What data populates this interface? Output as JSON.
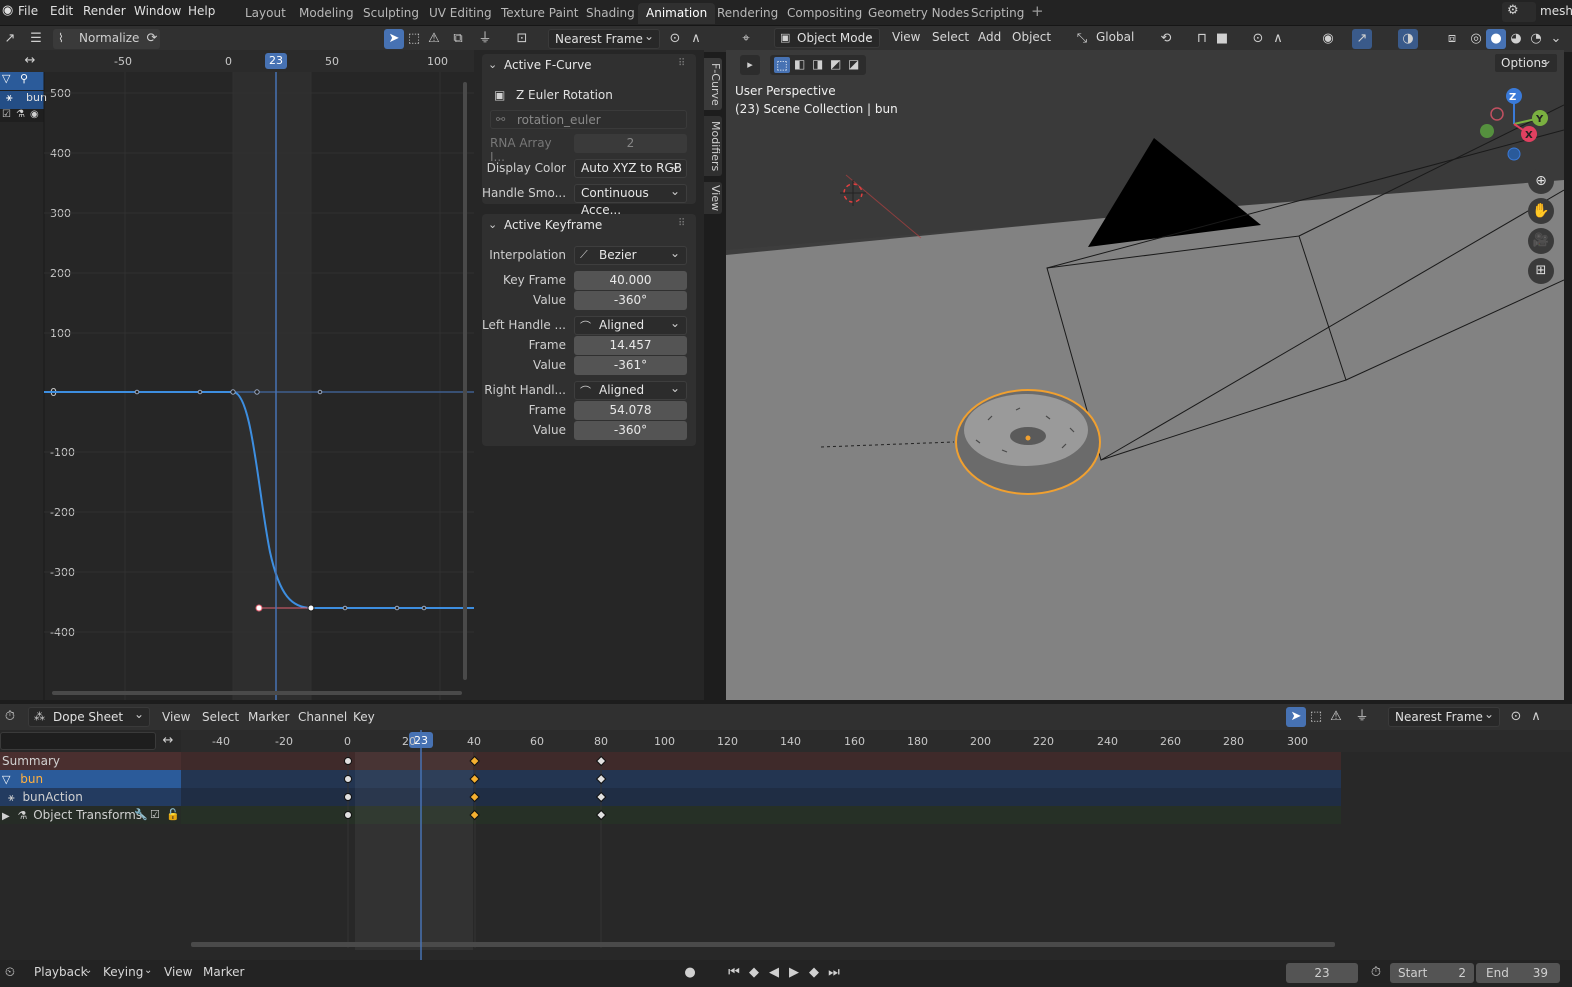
{
  "topbar": {
    "menus": [
      "File",
      "Edit",
      "Render",
      "Window",
      "Help"
    ],
    "workspaces": [
      "Layout",
      "Modeling",
      "Sculpting",
      "UV Editing",
      "Texture Paint",
      "Shading",
      "Animation",
      "Rendering",
      "Compositing",
      "Geometry Nodes",
      "Scripting"
    ],
    "active_workspace": "Animation",
    "scene_name": "mesh"
  },
  "graph_editor": {
    "normalize_label": "Normalize",
    "snap_mode": "Nearest Frame",
    "x_ticks": [
      "-50",
      "0",
      "50",
      "100"
    ],
    "current_frame": "23",
    "y_ticks": [
      "500",
      "400",
      "300",
      "200",
      "100",
      "0",
      "-100",
      "-200",
      "-300",
      "-400"
    ],
    "channel_name": "bun"
  },
  "properties": {
    "active_fcurve": {
      "title": "Active F-Curve",
      "channel": "Z Euler Rotation",
      "path": "rotation_euler",
      "array_index_label": "RNA Array I...",
      "array_index_value": "2",
      "display_color_label": "Display Color",
      "display_color_value": "Auto XYZ to RGB",
      "handle_smoothing_label": "Handle Smo...",
      "handle_smoothing_value": "Continuous Acce..."
    },
    "active_keyframe": {
      "title": "Active Keyframe",
      "interpolation_label": "Interpolation",
      "interpolation_value": "Bezier",
      "key_frame_label": "Key Frame",
      "key_frame_value": "40.000",
      "value_label": "Value",
      "value_value": "-360°",
      "left_handle_label": "Left Handle ...",
      "left_handle_type": "Aligned",
      "left_frame_label": "Frame",
      "left_frame_value": "14.457",
      "left_value_label": "Value",
      "left_value_value": "-361°",
      "right_handle_label": "Right Handl...",
      "right_handle_type": "Aligned",
      "right_frame_label": "Frame",
      "right_frame_value": "54.078",
      "right_value_label": "Value",
      "right_value_value": "-360°"
    },
    "side_tabs": [
      "F-Curve",
      "Modifiers",
      "View"
    ]
  },
  "viewport": {
    "editor_menus": [
      "View",
      "Select",
      "Add",
      "Object"
    ],
    "mode": "Object Mode",
    "orientation": "Global",
    "options_label": "Options",
    "perspective_label": "User Perspective",
    "collection_label": "(23) Scene Collection | bun",
    "gizmo_axes": [
      "Z",
      "Y",
      "X"
    ]
  },
  "dope_sheet": {
    "editor_label": "Dope Sheet",
    "menus": [
      "View",
      "Select",
      "Marker",
      "Channel",
      "Key"
    ],
    "snap_mode": "Nearest Frame",
    "x_ticks": [
      "-40",
      "-20",
      "0",
      "20",
      "40",
      "60",
      "80",
      "100",
      "120",
      "140",
      "160",
      "180",
      "200",
      "220",
      "240",
      "260",
      "280",
      "300"
    ],
    "current_frame": "23",
    "channels": [
      {
        "name": "Summary"
      },
      {
        "name": "bun"
      },
      {
        "name": "bunAction"
      },
      {
        "name": "Object Transforms"
      }
    ],
    "keyframes": [
      0,
      40,
      80
    ]
  },
  "statusbar": {
    "menus": [
      "Playback",
      "Keying",
      "View",
      "Marker"
    ],
    "current_frame": "23",
    "start_label": "Start",
    "start_value": "2",
    "end_label": "End",
    "end_value": "39"
  },
  "colors": {
    "accent": "#4772b3",
    "curve": "#3d8ee0",
    "selected_outline": "#f0a030",
    "keyframe_selected": "#f5b030"
  }
}
